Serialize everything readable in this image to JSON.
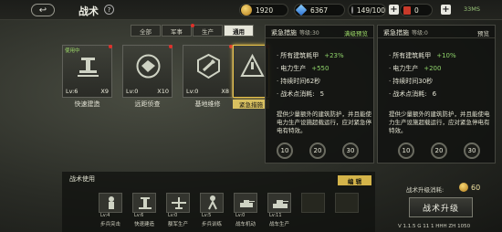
{
  "header": {
    "back_icon": "back-arrow-icon",
    "title": "战术",
    "help": "?"
  },
  "resources": {
    "gold": "1920",
    "gems": "6367",
    "stamina": "149/100",
    "flag_count": "0",
    "plus": "+"
  },
  "system": {
    "status": "33MS"
  },
  "tabs": [
    {
      "label": "全部"
    },
    {
      "label": "军事"
    },
    {
      "label": "生产"
    },
    {
      "label": "通用"
    }
  ],
  "cards": [
    {
      "name": "快速建造",
      "lv": "Lv:6",
      "count": "X9",
      "tag": "使用中"
    },
    {
      "name": "远距侦查",
      "lv": "Lv:0",
      "count": "X10",
      "tag": ""
    },
    {
      "name": "基地维修",
      "lv": "Lv:0",
      "count": "X8",
      "tag": ""
    },
    {
      "name": "紧急措施",
      "lv": "",
      "count": "",
      "tag": ""
    }
  ],
  "detail_current": {
    "name": "紧急措施",
    "level": "等级:30",
    "tag": "满级预览",
    "stats": [
      {
        "label": "所有建筑耗甲",
        "value": "+23%"
      },
      {
        "label": "电力生产",
        "value": "+550"
      },
      {
        "label": "持续时间62秒",
        "value": ""
      },
      {
        "label": "战术点消耗:",
        "value": "5"
      }
    ],
    "desc": "提供少量额外的建筑防护，并且能使电力生产设施超载运行，应对紧急停电有特效。",
    "levels": [
      "10",
      "20",
      "30"
    ]
  },
  "detail_preview": {
    "name": "紧急措施",
    "level": "等级:0",
    "tag": "预览",
    "stats": [
      {
        "label": "所有建筑耗甲",
        "value": "+10%"
      },
      {
        "label": "电力生产",
        "value": "+200"
      },
      {
        "label": "持续时间30秒",
        "value": ""
      },
      {
        "label": "战术点消耗:",
        "value": "6"
      }
    ],
    "desc": "提供少量额外的建筑防护，并且能使电力生产设施超载运行，应对紧急停电有特效。",
    "levels": [
      "10",
      "20",
      "30"
    ]
  },
  "usage": {
    "title": "战术使用",
    "edit_label": "编 辑",
    "slots": [
      {
        "lv": "Lv:4",
        "name": "步兵突击"
      },
      {
        "lv": "Lv:6",
        "name": "快速建造"
      },
      {
        "lv": "Lv:0",
        "name": "额军生产"
      },
      {
        "lv": "Lv:5",
        "name": "步兵训练"
      },
      {
        "lv": "Lv:0",
        "name": "战车机动"
      },
      {
        "lv": "Lv:11",
        "name": "战车生产"
      }
    ]
  },
  "upgrade": {
    "label": "战术升级消耗:",
    "cost": "60",
    "button": "战术升级"
  },
  "footer": {
    "status": "V 1.1.5 G 11 1 HHH ZH 1050"
  }
}
